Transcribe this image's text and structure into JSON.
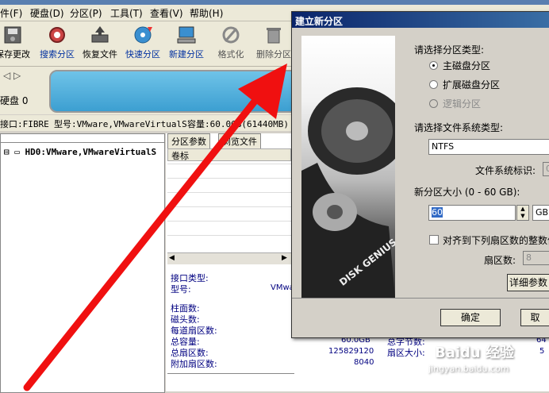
{
  "menu": [
    "件(F)",
    "硬盘(D)",
    "分区(P)",
    "工具(T)",
    "查看(V)",
    "帮助(H)"
  ],
  "toolbar": {
    "save": "保存更改",
    "search": "搜索分区",
    "restore": "恢复文件",
    "quick": "快速分区",
    "new": "新建分区",
    "format": "格式化",
    "delete": "删除分区"
  },
  "diskbar": {
    "disk_label": "硬盘 0"
  },
  "infoline": {
    "interface": "接口:FIBRE",
    "model": "型号:VMware,VMwareVirtualS",
    "capacity": "容量:60.0GB(61440MB)"
  },
  "tree": {
    "root": "HD0:VMware,VMwareVirtualS"
  },
  "tabs": [
    "分区参数",
    "浏览文件"
  ],
  "table": {
    "col1": "卷标"
  },
  "props": {
    "iface_label": "接口类型:",
    "model_label": "型号:",
    "model_value": "VMwa",
    "cyl": "柱面数:",
    "heads": "磁头数:",
    "spt": "每道扇区数:",
    "total_cap": "总容量:",
    "total_cap_val": "60.0GB",
    "total_sec": "总扇区数:",
    "total_sec_val": "125829120",
    "extra_sec": "附加扇区数:",
    "extra_sec_val": "8040",
    "bytes": "总字节数:",
    "bytes_val": "64",
    "sector_size": "扇区大小:",
    "sector_size_val": "5"
  },
  "dialog": {
    "title": "建立新分区",
    "type_prompt": "请选择分区类型:",
    "primary": "主磁盘分区",
    "extended": "扩展磁盘分区",
    "logical": "逻辑分区",
    "fs_prompt": "请选择文件系统类型:",
    "fs_value": "NTFS",
    "fs_id_label": "文件系统标识:",
    "fs_id_value": "0",
    "size_label": "新分区大小 (0 - 60 GB):",
    "size_value": "60",
    "unit": "GB",
    "align_label": "对齐到下列扇区数的整数倍",
    "sectors_label": "扇区数:",
    "sectors_value": "8",
    "advanced": "详细参数",
    "ok": "确定",
    "cancel": "取"
  },
  "image_text": "DISK GENIUS",
  "watermark": {
    "main": "Baidu 经验",
    "sub": "jingyan.baidu.com"
  }
}
